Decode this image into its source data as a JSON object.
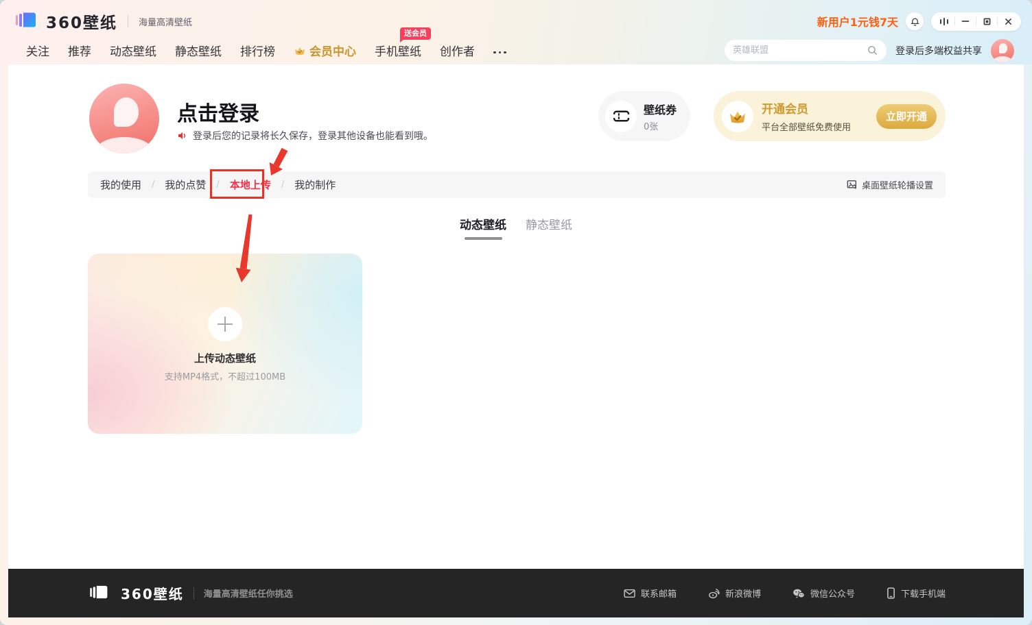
{
  "colors": {
    "accent_red": "#fb2e46",
    "annotation_red": "#ec3123",
    "promo_orange": "#ff6012",
    "vip_gold": "#cf9a2f",
    "badge_red": "#f8405c",
    "footer_bg": "#252526"
  },
  "icons": {
    "logo_mark": "360-wallpaper-stacked-pages",
    "bell": "notification-bell",
    "window_more": "three-bars",
    "search": "magnifier",
    "speaker": "announcement-horn",
    "ticket": "wallpaper-coupon-ticket",
    "crown": "vip-crown",
    "image": "picture-carousel",
    "plus": "upload-plus",
    "envelope": "mail",
    "weibo": "sina-weibo",
    "wechat": "wechat-bubbles",
    "phone": "mobile-phone"
  },
  "titlebar": {
    "logo_text": "360壁纸",
    "tagline": "海量高清壁纸",
    "promo": "新用户1元钱7天"
  },
  "nav": {
    "items": [
      "关注",
      "推荐",
      "动态壁纸",
      "静态壁纸",
      "排行榜",
      "会员中心",
      "手机壁纸",
      "创作者"
    ],
    "badge": "送会员",
    "search_placeholder": "英雄联盟",
    "login_share": "登录后多端权益共享"
  },
  "profile": {
    "login_title": "点击登录",
    "login_tip": "登录后您的记录将长久保存，登录其他设备也能看到哦。",
    "coupon_title": "壁纸券",
    "coupon_count": "0张",
    "vip_title": "开通会员",
    "vip_desc": "平台全部壁纸免费使用",
    "vip_button": "立即开通"
  },
  "tabs": {
    "items": [
      "我的使用",
      "我的点赞",
      "本地上传",
      "我的制作"
    ],
    "active": "本地上传",
    "separator": "/",
    "settings": "桌面壁纸轮播设置"
  },
  "content": {
    "tabs": [
      "动态壁纸",
      "静态壁纸"
    ],
    "active": "动态壁纸",
    "upload_title": "上传动态壁纸",
    "upload_hint": "支持MP4格式，不超过100MB"
  },
  "footer": {
    "logo_text": "360壁纸",
    "tagline": "海量高清壁纸任你挑选",
    "links": [
      "联系邮箱",
      "新浪微博",
      "微信公众号",
      "下载手机端"
    ]
  }
}
